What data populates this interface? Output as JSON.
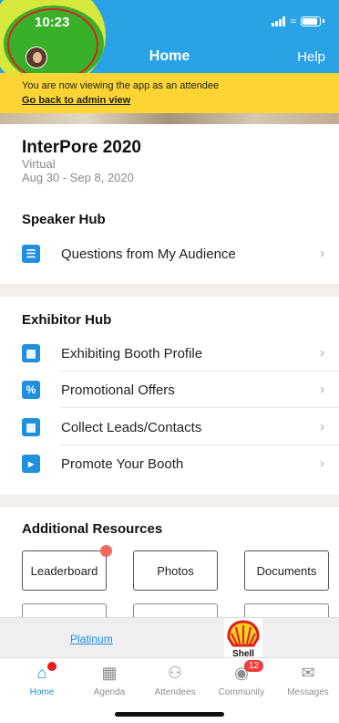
{
  "status": {
    "time": "10:23"
  },
  "nav": {
    "title": "Home",
    "help": "Help"
  },
  "banner": {
    "text": "You are now viewing the app as an attendee",
    "link": "Go back to admin view"
  },
  "event": {
    "title": "InterPore 2020",
    "type": "Virtual",
    "dates": "Aug 30 - Sep 8, 2020"
  },
  "speaker_hub": {
    "title": "Speaker Hub",
    "items": [
      {
        "label": "Questions from My Audience",
        "icon": "list-icon"
      }
    ]
  },
  "exhibitor_hub": {
    "title": "Exhibitor Hub",
    "items": [
      {
        "label": "Exhibiting Booth Profile",
        "icon": "booth-icon"
      },
      {
        "label": "Promotional Offers",
        "icon": "percent-icon"
      },
      {
        "label": "Collect Leads/Contacts",
        "icon": "qr-code-icon"
      },
      {
        "label": "Promote Your Booth",
        "icon": "megaphone-icon"
      }
    ]
  },
  "resources": {
    "title": "Additional Resources",
    "buttons": [
      "Leaderboard",
      "Photos",
      "Documents"
    ]
  },
  "sponsor": {
    "label": "Platinum",
    "logo_text": "Shell"
  },
  "tabs": [
    {
      "label": "Home",
      "icon": "home-icon",
      "active": true
    },
    {
      "label": "Agenda",
      "icon": "calendar-icon"
    },
    {
      "label": "Attendees",
      "icon": "people-icon"
    },
    {
      "label": "Community",
      "icon": "chat-icon",
      "badge": "12"
    },
    {
      "label": "Messages",
      "icon": "envelope-icon"
    }
  ],
  "colors": {
    "header": "#2aa3e6",
    "banner": "#fcd535",
    "accent": "#1f8fe0",
    "badge": "#f23c3c"
  }
}
